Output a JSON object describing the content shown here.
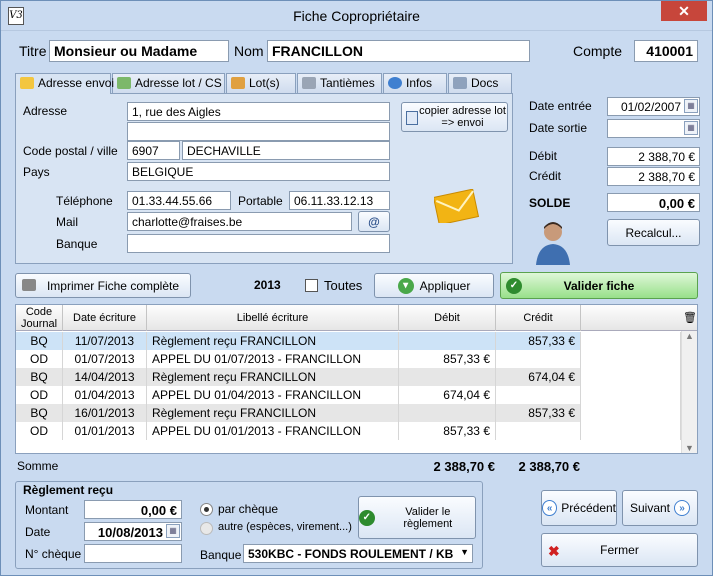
{
  "window": {
    "title": "Fiche Copropriétaire",
    "icon_text": "V3"
  },
  "header": {
    "titre_label": "Titre",
    "titre_value": "Monsieur ou Madame",
    "nom_label": "Nom",
    "nom_value": "FRANCILLON",
    "compte_label": "Compte",
    "compte_value": "410001"
  },
  "tabs": [
    {
      "label": "Adresse envoi",
      "icon": "envelope-icon"
    },
    {
      "label": "Adresse lot / CS",
      "icon": "building-icon"
    },
    {
      "label": "Lot(s)",
      "icon": "house-icon"
    },
    {
      "label": "Tantièmes",
      "icon": "ruler-icon"
    },
    {
      "label": "Infos",
      "icon": "info-icon"
    },
    {
      "label": "Docs",
      "icon": "folder-icon"
    }
  ],
  "address": {
    "adresse_label": "Adresse",
    "adresse1": "1, rue des Aigles",
    "adresse2": "",
    "cp_label": "Code postal / ville",
    "cp": "6907",
    "ville": "DECHAVILLE",
    "pays_label": "Pays",
    "pays": "BELGIQUE",
    "tel_label": "Téléphone",
    "tel": "01.33.44.55.66",
    "portable_label": "Portable",
    "portable": "06.11.33.12.13",
    "mail_label": "Mail",
    "mail": "charlotte@fraises.be",
    "banque_label": "Banque",
    "banque": "",
    "copy_button": "copier adresse lot => envoi"
  },
  "right": {
    "date_entree_label": "Date entrée",
    "date_entree": "01/02/2007",
    "date_sortie_label": "Date sortie",
    "date_sortie": "",
    "debit_label": "Débit",
    "debit": "2 388,70 €",
    "credit_label": "Crédit",
    "credit": "2 388,70 €",
    "solde_label": "SOLDE",
    "solde": "0,00 €",
    "recalcul_button": "Recalcul..."
  },
  "toolbar": {
    "print_button": "Imprimer Fiche complète",
    "year": "2013",
    "toutes_label": "Toutes",
    "appliquer_button": "Appliquer",
    "valider_fiche_button": "Valider fiche"
  },
  "grid": {
    "headers": [
      "Code Journal",
      "Date écriture",
      "Libellé écriture",
      "Débit",
      "Crédit"
    ],
    "rows": [
      {
        "journal": "BQ",
        "date": "11/07/2013",
        "libelle": "Règlement reçu FRANCILLON",
        "debit": "",
        "credit": "857,33 €"
      },
      {
        "journal": "OD",
        "date": "01/07/2013",
        "libelle": "APPEL DU 01/07/2013 - FRANCILLON",
        "debit": "857,33 €",
        "credit": ""
      },
      {
        "journal": "BQ",
        "date": "14/04/2013",
        "libelle": "Règlement reçu FRANCILLON",
        "debit": "",
        "credit": "674,04 €"
      },
      {
        "journal": "OD",
        "date": "01/04/2013",
        "libelle": "APPEL DU 01/04/2013 - FRANCILLON",
        "debit": "674,04 €",
        "credit": ""
      },
      {
        "journal": "BQ",
        "date": "16/01/2013",
        "libelle": "Règlement reçu FRANCILLON",
        "debit": "",
        "credit": "857,33 €"
      },
      {
        "journal": "OD",
        "date": "01/01/2013",
        "libelle": "APPEL DU 01/01/2013 - FRANCILLON",
        "debit": "857,33 €",
        "credit": ""
      }
    ],
    "somme_label": "Somme",
    "somme_debit": "2 388,70 €",
    "somme_credit": "2 388,70 €"
  },
  "reglement": {
    "title": "Règlement reçu",
    "montant_label": "Montant",
    "montant": "0,00 €",
    "date_label": "Date",
    "date": "10/08/2013",
    "cheque_label": "N° chèque",
    "cheque": "",
    "par_cheque": "par chèque",
    "autre": "autre (espèces, virement...)",
    "valider_button": "Valider le règlement",
    "banque_label": "Banque",
    "banque": "530KBC - FONDS ROULEMENT / KB"
  },
  "nav": {
    "precedent": "Précédent",
    "suivant": "Suivant",
    "fermer": "Fermer"
  },
  "colors": {
    "accent": "#c9daf0",
    "selected_row": "#cde3f7",
    "alt_row": "#e6e6e6",
    "green_button": "#6fcf6f"
  }
}
